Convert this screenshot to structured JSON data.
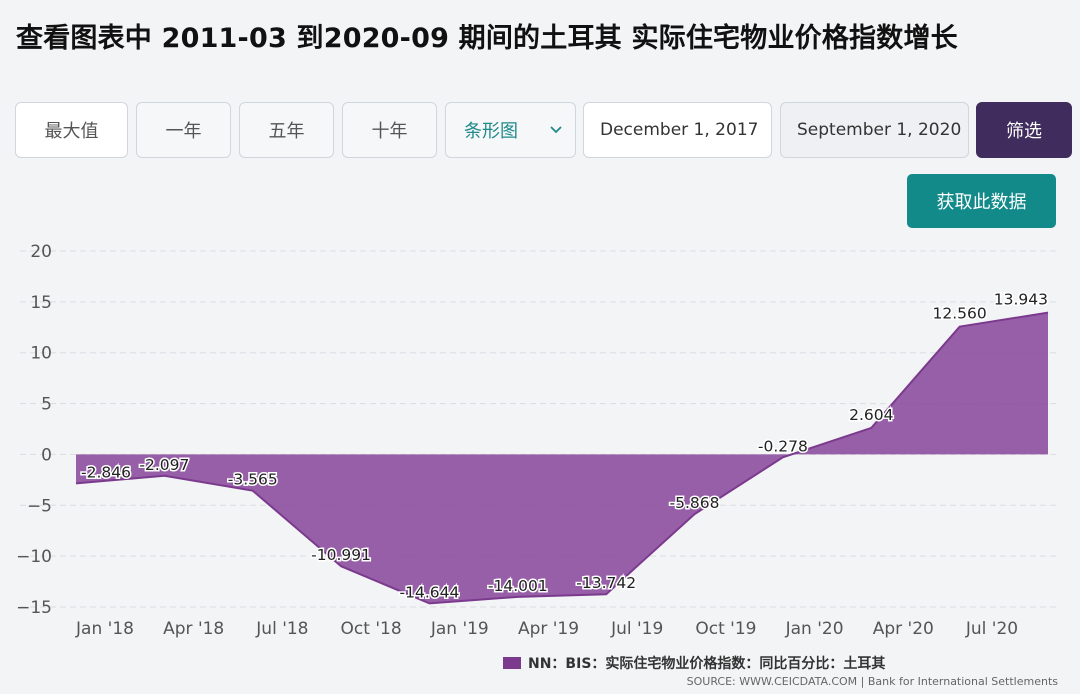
{
  "title": "查看图表中 2011-03 到2020-09 期间的土耳其 实际住宅物业价格指数增长",
  "toolbar": {
    "max": "最大值",
    "one_year": "一年",
    "five_year": "五年",
    "ten_year": "十年",
    "chart_type": "条形图",
    "start_date": "December 1, 2017",
    "end_date": "September 1, 2020",
    "filter": "筛选",
    "get_data": "获取此数据"
  },
  "colors": {
    "area_fill": "#8a4a9c",
    "area_line": "#7b3a8d",
    "filter_bg": "#412d5d",
    "get_data_bg": "#138a8a"
  },
  "chart_data": {
    "type": "area",
    "x": [
      "2017-12",
      "2018-03",
      "2018-06",
      "2018-09",
      "2018-12",
      "2019-03",
      "2019-06",
      "2019-09",
      "2019-12",
      "2020-03",
      "2020-06",
      "2020-09"
    ],
    "series": [
      {
        "name": "NN：BIS：实际住宅物业价格指数：同比百分比：土耳其",
        "values": [
          -2.846,
          -2.097,
          -3.565,
          -10.991,
          -14.644,
          -14.001,
          -13.742,
          -5.868,
          -0.278,
          2.604,
          12.56,
          13.943
        ]
      }
    ],
    "data_labels": [
      "-2.846",
      "-2.097",
      "-3.565",
      "-10.991",
      "-14.644",
      "-14.001",
      "-13.742",
      "-5.868",
      "-0.278",
      "2.604",
      "12.560",
      "13.943"
    ],
    "x_tick_labels": [
      "Jan '18",
      "Apr '18",
      "Jul '18",
      "Oct '18",
      "Jan '19",
      "Apr '19",
      "Jul '19",
      "Oct '19",
      "Jan '20",
      "Apr '20",
      "Jul '20"
    ],
    "y_ticks": [
      "20",
      "15",
      "10",
      "5",
      "0",
      "−5",
      "−10",
      "−15"
    ],
    "y_tick_values": [
      20,
      15,
      10,
      5,
      0,
      -5,
      -10,
      -15
    ],
    "ylim": [
      -15,
      20
    ],
    "grid": true,
    "legend_position": "bottom-right"
  },
  "legend": {
    "label": "NN：BIS：实际住宅物业价格指数：同比百分比：土耳其"
  },
  "source": "SOURCE: WWW.CEICDATA.COM | Bank for International Settlements"
}
